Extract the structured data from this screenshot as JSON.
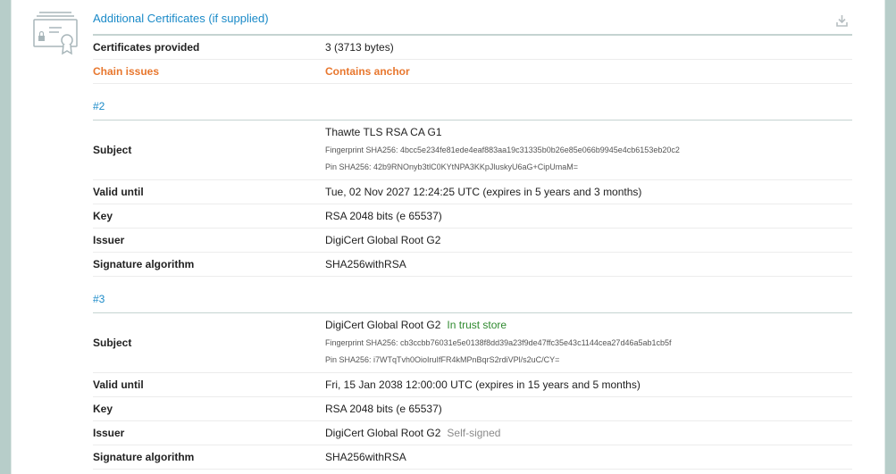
{
  "section": {
    "title": "Additional Certificates (if supplied)",
    "icon": "certificate-icon",
    "download_icon": "download-icon"
  },
  "summary": {
    "certs_label": "Certificates provided",
    "certs_value": "3 (3713 bytes)",
    "chain_label": "Chain issues",
    "chain_value": "Contains anchor"
  },
  "certs": [
    {
      "heading": "#2",
      "subject_label": "Subject",
      "subject_name": "Thawte TLS RSA CA G1",
      "subject_badge": "",
      "fingerprint": "Fingerprint SHA256: 4bcc5e234fe81ede4eaf883aa19c31335b0b26e85e066b9945e4cb6153eb20c2",
      "pin": "Pin SHA256: 42b9RNOnyb3tlC0KYtNPA3KKpJluskyU6aG+CipUmaM=",
      "valid_label": "Valid until",
      "valid_value": "Tue, 02 Nov 2027 12:24:25 UTC (expires in 5 years and 3 months)",
      "key_label": "Key",
      "key_value": "RSA 2048 bits (e 65537)",
      "issuer_label": "Issuer",
      "issuer_value": "DigiCert Global Root G2",
      "issuer_badge": "",
      "sig_label": "Signature algorithm",
      "sig_value": "SHA256withRSA"
    },
    {
      "heading": "#3",
      "subject_label": "Subject",
      "subject_name": "DigiCert Global Root G2",
      "subject_badge": "In trust store",
      "fingerprint": "Fingerprint SHA256: cb3ccbb76031e5e0138f8dd39a23f9de47ffc35e43c1144cea27d46a5ab1cb5f",
      "pin": "Pin SHA256: i7WTqTvh0OioIruIfFR4kMPnBqrS2rdiVPl/s2uC/CY=",
      "valid_label": "Valid until",
      "valid_value": "Fri, 15 Jan 2038 12:00:00 UTC (expires in 15 years and 5 months)",
      "key_label": "Key",
      "key_value": "RSA 2048 bits (e 65537)",
      "issuer_label": "Issuer",
      "issuer_value": "DigiCert Global Root G2",
      "issuer_badge": "Self-signed",
      "sig_label": "Signature algorithm",
      "sig_value": "SHA256withRSA"
    }
  ],
  "colors": {
    "title_blue": "#1a8ac8",
    "warning_orange": "#e8772e",
    "trust_green": "#2f8a2f",
    "frame_teal": "#b7cdc9"
  }
}
